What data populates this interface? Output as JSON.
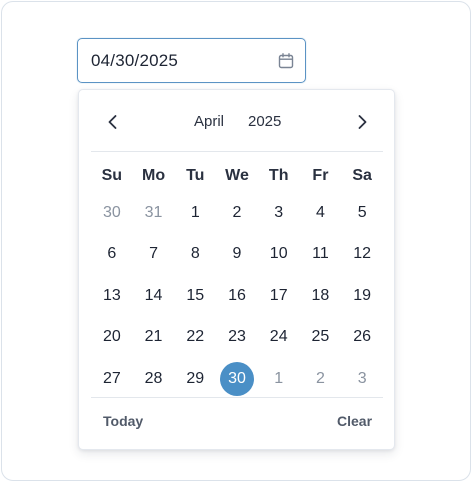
{
  "date_field": {
    "value": "04/30/2025",
    "icon": "calendar-icon"
  },
  "calendar": {
    "month": "April",
    "year": "2025",
    "prev_icon": "chevron-left-icon",
    "next_icon": "chevron-right-icon",
    "weekdays": [
      "Su",
      "Mo",
      "Tu",
      "We",
      "Th",
      "Fr",
      "Sa"
    ],
    "days": [
      {
        "label": "30",
        "muted": true,
        "selected": false
      },
      {
        "label": "31",
        "muted": true,
        "selected": false
      },
      {
        "label": "1",
        "muted": false,
        "selected": false
      },
      {
        "label": "2",
        "muted": false,
        "selected": false
      },
      {
        "label": "3",
        "muted": false,
        "selected": false
      },
      {
        "label": "4",
        "muted": false,
        "selected": false
      },
      {
        "label": "5",
        "muted": false,
        "selected": false
      },
      {
        "label": "6",
        "muted": false,
        "selected": false
      },
      {
        "label": "7",
        "muted": false,
        "selected": false
      },
      {
        "label": "8",
        "muted": false,
        "selected": false
      },
      {
        "label": "9",
        "muted": false,
        "selected": false
      },
      {
        "label": "10",
        "muted": false,
        "selected": false
      },
      {
        "label": "11",
        "muted": false,
        "selected": false
      },
      {
        "label": "12",
        "muted": false,
        "selected": false
      },
      {
        "label": "13",
        "muted": false,
        "selected": false
      },
      {
        "label": "14",
        "muted": false,
        "selected": false
      },
      {
        "label": "15",
        "muted": false,
        "selected": false
      },
      {
        "label": "16",
        "muted": false,
        "selected": false
      },
      {
        "label": "17",
        "muted": false,
        "selected": false
      },
      {
        "label": "18",
        "muted": false,
        "selected": false
      },
      {
        "label": "19",
        "muted": false,
        "selected": false
      },
      {
        "label": "20",
        "muted": false,
        "selected": false
      },
      {
        "label": "21",
        "muted": false,
        "selected": false
      },
      {
        "label": "22",
        "muted": false,
        "selected": false
      },
      {
        "label": "23",
        "muted": false,
        "selected": false
      },
      {
        "label": "24",
        "muted": false,
        "selected": false
      },
      {
        "label": "25",
        "muted": false,
        "selected": false
      },
      {
        "label": "26",
        "muted": false,
        "selected": false
      },
      {
        "label": "27",
        "muted": false,
        "selected": false
      },
      {
        "label": "28",
        "muted": false,
        "selected": false
      },
      {
        "label": "29",
        "muted": false,
        "selected": false
      },
      {
        "label": "30",
        "muted": false,
        "selected": true
      },
      {
        "label": "1",
        "muted": true,
        "selected": false
      },
      {
        "label": "2",
        "muted": true,
        "selected": false
      },
      {
        "label": "3",
        "muted": true,
        "selected": false
      }
    ],
    "today_label": "Today",
    "clear_label": "Clear"
  },
  "colors": {
    "accent": "#4a8fc6",
    "input_border": "#5b93c4",
    "text": "#1d2433",
    "muted_text": "#8a93a0"
  }
}
